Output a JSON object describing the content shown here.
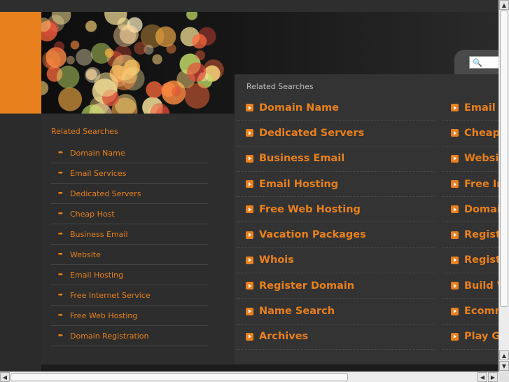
{
  "colors": {
    "accent": "#e8801e",
    "background": "#2b2b2b",
    "panel": "#333333",
    "muted_text": "#bdbdbd"
  },
  "sidebar": {
    "title": "Related Searches",
    "items": [
      {
        "label": "Domain Name"
      },
      {
        "label": "Email Services"
      },
      {
        "label": "Dedicated Servers"
      },
      {
        "label": "Cheap Host"
      },
      {
        "label": "Business Email"
      },
      {
        "label": "Website"
      },
      {
        "label": "Email Hosting"
      },
      {
        "label": "Free Internet Service"
      },
      {
        "label": "Free Web Hosting"
      },
      {
        "label": "Domain Registration"
      }
    ]
  },
  "search": {
    "icon": "search-icon",
    "value": ""
  },
  "main": {
    "title": "Related Searches",
    "left_links": [
      {
        "label": "Domain Name"
      },
      {
        "label": "Dedicated Servers"
      },
      {
        "label": "Business Email"
      },
      {
        "label": "Email Hosting"
      },
      {
        "label": "Free Web Hosting"
      },
      {
        "label": "Vacation Packages"
      },
      {
        "label": "Whois"
      },
      {
        "label": "Register Domain"
      },
      {
        "label": "Name Search"
      },
      {
        "label": "Archives"
      }
    ],
    "right_links": [
      {
        "label": "Email S"
      },
      {
        "label": "Cheap"
      },
      {
        "label": "Website"
      },
      {
        "label": "Free Int"
      },
      {
        "label": "Domain"
      },
      {
        "label": "Registe"
      },
      {
        "label": "Registra"
      },
      {
        "label": "Build W"
      },
      {
        "label": "Ecomm"
      },
      {
        "label": "Play Ga"
      }
    ]
  }
}
